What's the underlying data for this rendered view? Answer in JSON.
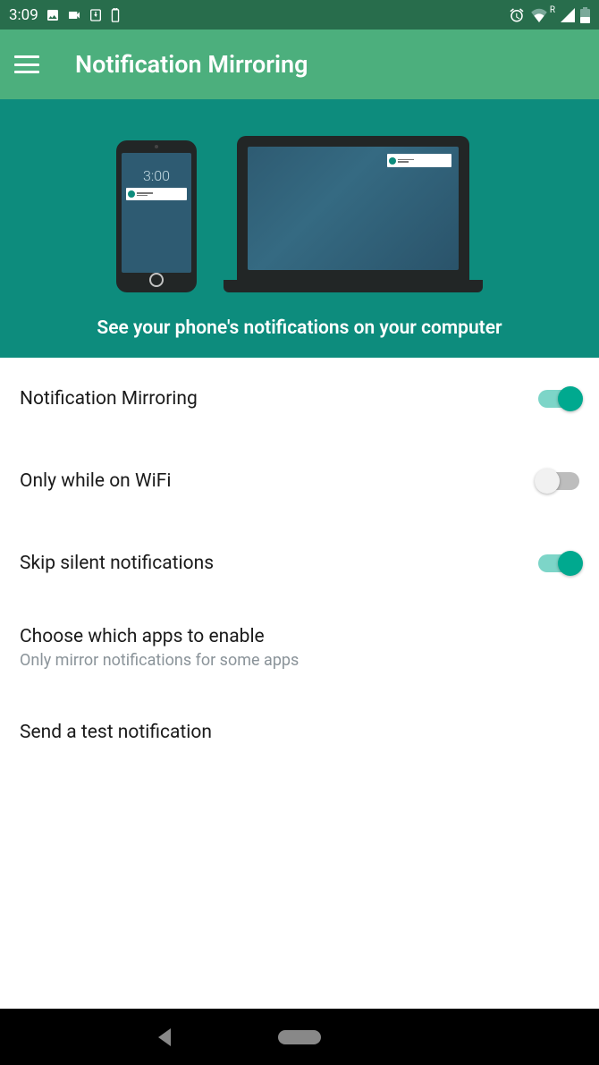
{
  "status": {
    "time": "3:09",
    "roaming": "R"
  },
  "appbar": {
    "title": "Notification Mirroring"
  },
  "hero": {
    "phone_time": "3:00",
    "caption": "See your phone's notifications on your computer"
  },
  "settings": [
    {
      "title": "Notification Mirroring",
      "sub": "",
      "toggle": "on"
    },
    {
      "title": "Only while on WiFi",
      "sub": "",
      "toggle": "off"
    },
    {
      "title": "Skip silent notifications",
      "sub": "",
      "toggle": "on"
    },
    {
      "title": "Choose which apps to enable",
      "sub": "Only mirror notifications for some apps",
      "toggle": ""
    },
    {
      "title": "Send a test notification",
      "sub": "",
      "toggle": ""
    }
  ]
}
